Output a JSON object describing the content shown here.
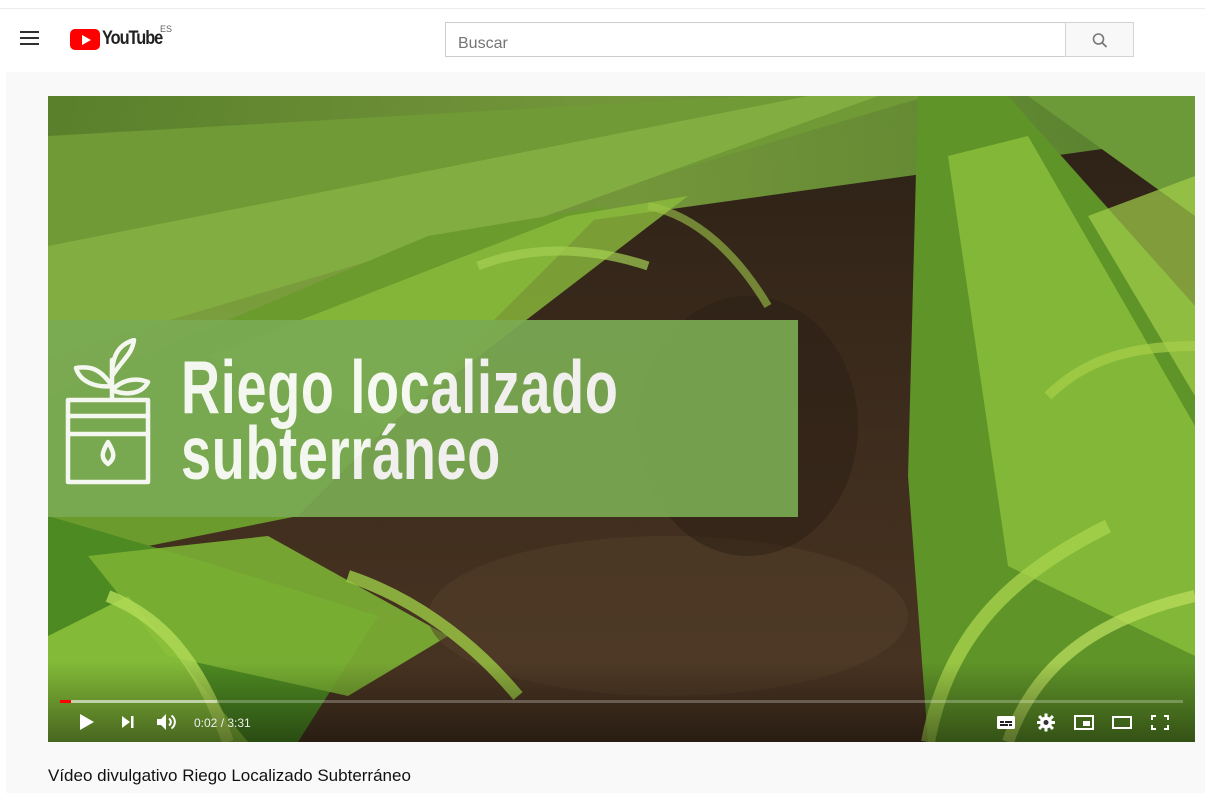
{
  "header": {
    "logo_text": "YouTube",
    "region": "ES",
    "search_placeholder": "Buscar"
  },
  "player": {
    "overlay_line1": "Riego localizado",
    "overlay_line2": "subterráneo",
    "current_time": "0:02",
    "separator": " / ",
    "duration": "3:31",
    "progress_played": 0.0095,
    "progress_loaded": 0.14
  },
  "video": {
    "title": "Vídeo divulgativo Riego Localizado Subterráneo"
  },
  "colors": {
    "brand_red": "#ff0000",
    "banner_green": "#7aaa53"
  },
  "icons": {
    "menu": "hamburger-menu-icon",
    "search": "search-icon",
    "play": "play-icon",
    "next": "next-icon",
    "volume": "volume-icon",
    "subtitles": "subtitles-icon",
    "settings": "gear-icon",
    "miniplayer": "miniplayer-icon",
    "theater": "theater-mode-icon",
    "fullscreen": "fullscreen-icon"
  }
}
